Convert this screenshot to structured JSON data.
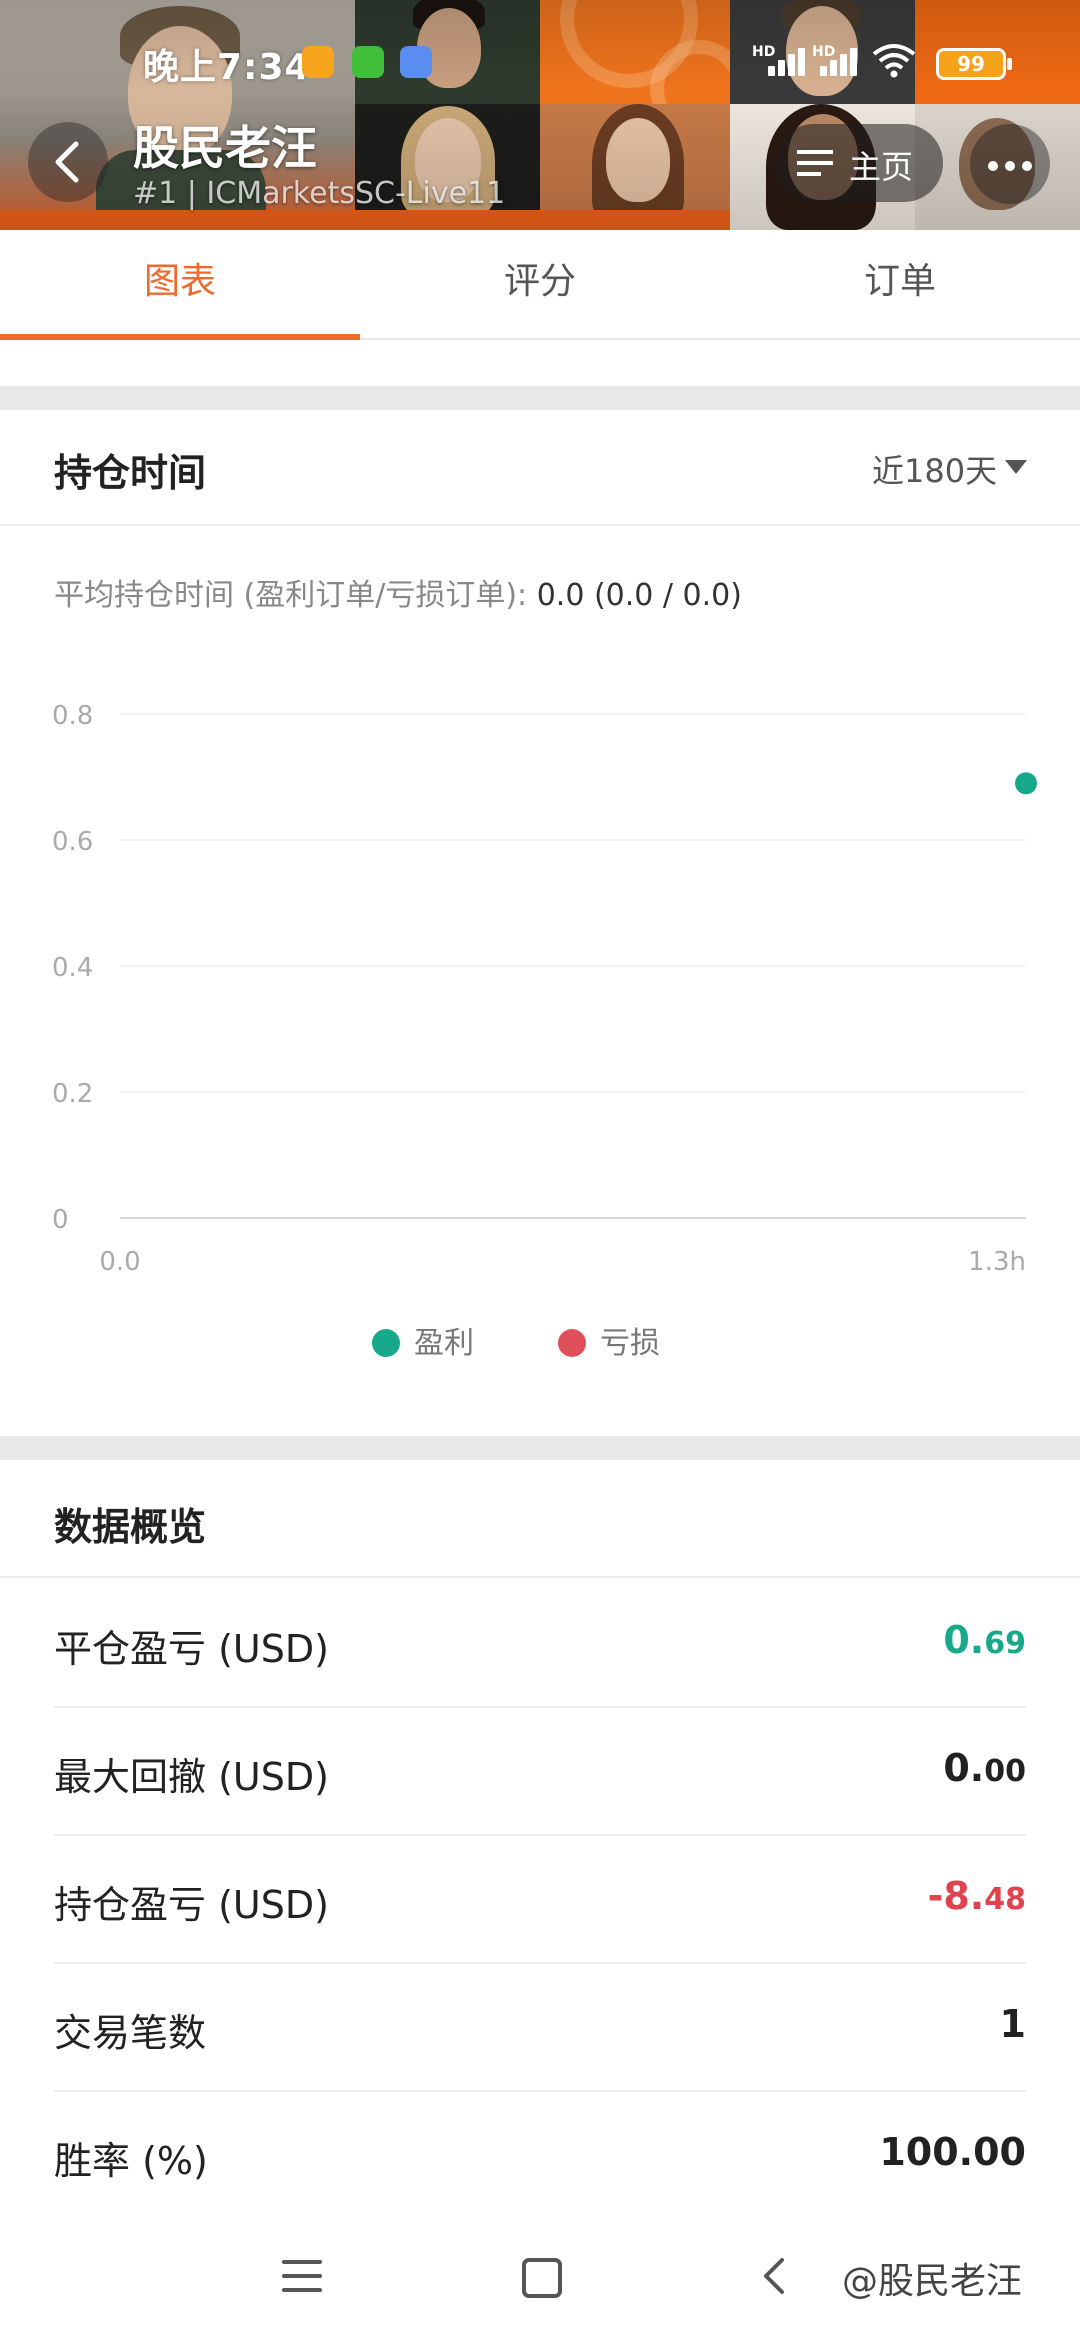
{
  "status_bar": {
    "time": "晚上7:34",
    "signal_1": "HD",
    "signal_2": "HD",
    "battery": "99"
  },
  "header": {
    "name": "股民老汪",
    "subtitle": "#1 | ICMarketsSC-Live11",
    "home_label": "主页"
  },
  "tabs": [
    {
      "label": "图表",
      "active": true
    },
    {
      "label": "评分",
      "active": false
    },
    {
      "label": "订单",
      "active": false
    }
  ],
  "holding_time": {
    "title": "持仓时间",
    "period": "近180天",
    "avg_label": "平均持仓时间 (盈利订单/亏损订单): ",
    "avg_value": "0.0 (0.0 / 0.0)"
  },
  "chart_data": {
    "type": "scatter",
    "x_ticks": [
      "0.0",
      "1.3h"
    ],
    "y_ticks": [
      "0",
      "0.2",
      "0.4",
      "0.6",
      "0.8"
    ],
    "ylim": [
      0,
      0.8
    ],
    "grid": true,
    "legend_position": "bottom-center",
    "series": [
      {
        "name": "盈利",
        "color": "#18a98b",
        "points": [
          {
            "x": 1.3,
            "y": 0.69
          }
        ]
      },
      {
        "name": "亏损",
        "color": "#e0505a",
        "points": []
      }
    ]
  },
  "overview": {
    "title": "数据概览",
    "rows": [
      {
        "label": "平仓盈亏 (USD)",
        "int": "0.",
        "dec": "69",
        "tone": "pos"
      },
      {
        "label": "最大回撤 (USD)",
        "int": "0.",
        "dec": "00",
        "tone": "normal"
      },
      {
        "label": "持仓盈亏 (USD)",
        "int": "-8.",
        "dec": "48",
        "tone": "neg"
      },
      {
        "label": "交易笔数",
        "int": "1",
        "dec": "",
        "tone": "normal"
      },
      {
        "label": "胜率 (%)",
        "int": "100.00",
        "dec": "",
        "tone": "normal"
      }
    ]
  },
  "watermark": "@股民老汪",
  "colors": {
    "accent": "#ef6a2b",
    "profit": "#18a98b",
    "loss": "#e0505a"
  }
}
